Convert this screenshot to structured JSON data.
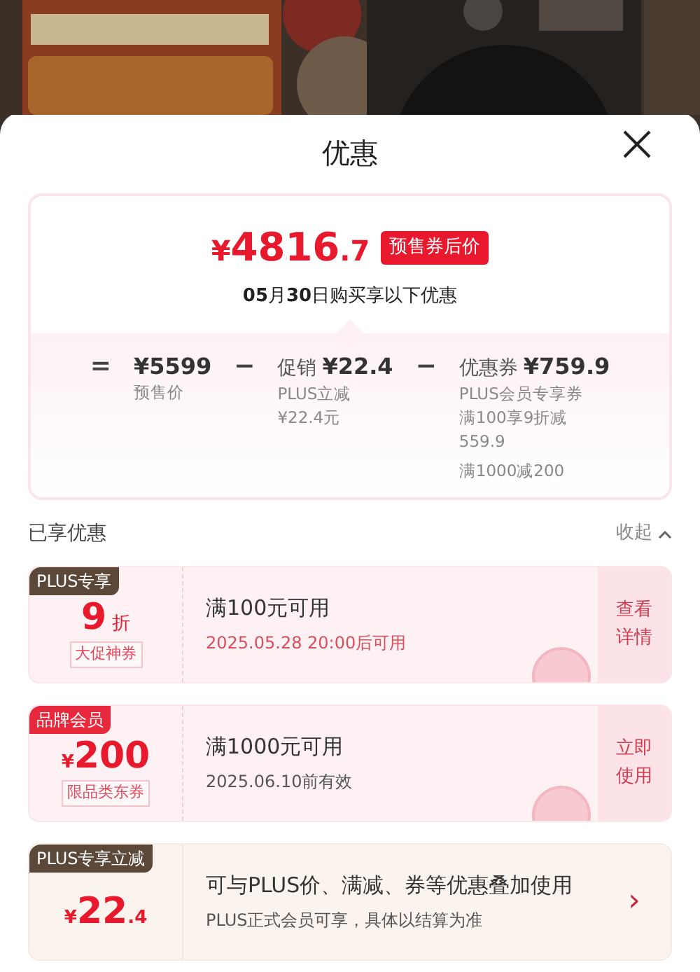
{
  "title": "优惠",
  "summary": {
    "currency": "¥",
    "price": "4816",
    "price_decimal": ".7",
    "price_tag": "预售券后价",
    "date_note": "**05**月**30**日购买享以下优惠",
    "breakdown": [
      {
        "operator": "=",
        "amount": "¥5599",
        "notes": [
          "预售价"
        ]
      },
      {
        "operator": "−",
        "label": "促销",
        "amount": "¥22.4",
        "notes": [
          "PLUS立减",
          "¥22.4元"
        ]
      },
      {
        "operator": "−",
        "label": "优惠券",
        "amount": "¥759.9",
        "notes": [
          "PLUS会员专享券",
          "满100享9折减559.9",
          "满1000减200"
        ]
      }
    ]
  },
  "section": {
    "title": "已享优惠",
    "toggle": "收起"
  },
  "coupons": [
    {
      "kind": "ticket",
      "tag": "PLUS专享",
      "color": "#5b4838",
      "value": "9",
      "suffix": "折",
      "sublabel": "大促神券",
      "title": "满100元可用",
      "subtitle": "2025.05.28 20:00后可用",
      "subtitle_alert": true,
      "action": "查看详情"
    },
    {
      "kind": "ticket",
      "tag": "品牌会员",
      "color": "#e8283c",
      "prefix": "¥",
      "value": "200",
      "sublabel": "限品类东券",
      "title": "满1000元可用",
      "subtitle": "2025.06.10前有效",
      "subtitle_alert": false,
      "action": "立即使用"
    },
    {
      "kind": "plus",
      "tag": "PLUS专享立减",
      "color": "#5b4838",
      "prefix": "¥",
      "value": "22",
      "suffix": ".4",
      "title": "可与PLUS价、满减、券等优惠叠加使用",
      "subtitle": "PLUS正式会员可享，具体以结算为准",
      "action": "›"
    }
  ]
}
